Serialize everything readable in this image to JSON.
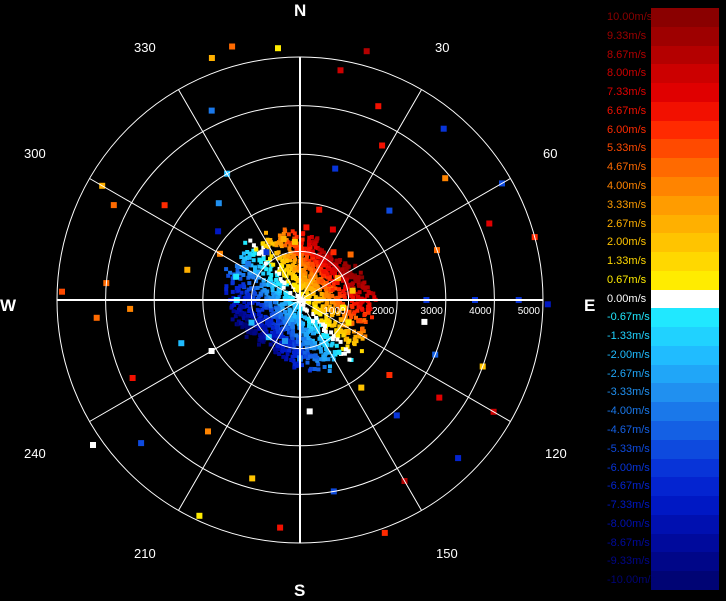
{
  "chart_data": {
    "type": "polar-radial-velocity",
    "compass": {
      "north": "N",
      "east": "E",
      "south": "S",
      "west": "W"
    },
    "azimuth_labels": [
      "30",
      "60",
      "120",
      "150",
      "210",
      "240",
      "300",
      "330"
    ],
    "range_ticks": [
      1000,
      2000,
      3000,
      4000,
      5000
    ],
    "range_tick_labels": [
      "1000",
      "2000",
      "3000",
      "4000",
      "5000"
    ],
    "rmax": 5000,
    "spokes_deg": [
      0,
      30,
      60,
      90,
      120,
      150,
      180,
      210,
      240,
      270,
      300,
      330
    ],
    "legend": [
      {
        "label": "10.00m/s",
        "color": "#8a0000"
      },
      {
        "label": "9.33m/s",
        "color": "#9e0000"
      },
      {
        "label": "8.67m/s",
        "color": "#b40000"
      },
      {
        "label": "8.00m/s",
        "color": "#cc0000"
      },
      {
        "label": "7.33m/s",
        "color": "#e00000"
      },
      {
        "label": "6.67m/s",
        "color": "#f21000"
      },
      {
        "label": "6.00m/s",
        "color": "#ff2a00"
      },
      {
        "label": "5.33m/s",
        "color": "#ff4a00"
      },
      {
        "label": "4.67m/s",
        "color": "#ff6a00"
      },
      {
        "label": "4.00m/s",
        "color": "#ff8400"
      },
      {
        "label": "3.33m/s",
        "color": "#ff9c00"
      },
      {
        "label": "2.67m/s",
        "color": "#ffb000"
      },
      {
        "label": "2.00m/s",
        "color": "#ffc400"
      },
      {
        "label": "1.33m/s",
        "color": "#ffd800"
      },
      {
        "label": "0.67m/s",
        "color": "#ffec00"
      },
      {
        "label": "0.00m/s",
        "color": "#ffffff"
      },
      {
        "label": "-0.67m/s",
        "color": "#20e8ff"
      },
      {
        "label": "-1.33m/s",
        "color": "#20d2ff"
      },
      {
        "label": "-2.00m/s",
        "color": "#20bcff"
      },
      {
        "label": "-2.67m/s",
        "color": "#20a6f8"
      },
      {
        "label": "-3.33m/s",
        "color": "#2090f0"
      },
      {
        "label": "-4.00m/s",
        "color": "#1a78ea"
      },
      {
        "label": "-4.67m/s",
        "color": "#1460e4"
      },
      {
        "label": "-5.33m/s",
        "color": "#0e4ade"
      },
      {
        "label": "-6.00m/s",
        "color": "#0834d8"
      },
      {
        "label": "-6.67m/s",
        "color": "#0424d0"
      },
      {
        "label": "-7.33m/s",
        "color": "#0018c4"
      },
      {
        "label": "-8.00m/s",
        "color": "#0010b0"
      },
      {
        "label": "-8.67m/s",
        "color": "#000a9c"
      },
      {
        "label": "-9.33m/s",
        "color": "#000688"
      },
      {
        "label": "-10.00m/s",
        "color": "#000474"
      }
    ],
    "points": [
      {
        "az": 5,
        "r": 1500,
        "v": 6.5
      },
      {
        "az": 12,
        "r": 1900,
        "v": 7.0
      },
      {
        "az": 25,
        "r": 1600,
        "v": 7.5
      },
      {
        "az": 35,
        "r": 1200,
        "v": 6.0
      },
      {
        "az": 48,
        "r": 1400,
        "v": 5.0
      },
      {
        "az": 60,
        "r": 900,
        "v": 3.5
      },
      {
        "az": 80,
        "r": 1100,
        "v": 2.0
      },
      {
        "az": 100,
        "r": 900,
        "v": 1.0
      },
      {
        "az": 115,
        "r": 1100,
        "v": 0.7
      },
      {
        "az": 130,
        "r": 1000,
        "v": 1.5
      },
      {
        "az": 150,
        "r": 1050,
        "v": -1.5
      },
      {
        "az": 165,
        "r": 1000,
        "v": -3.0
      },
      {
        "az": 180,
        "r": 1200,
        "v": -4.0
      },
      {
        "az": 200,
        "r": 900,
        "v": -3.0
      },
      {
        "az": 220,
        "r": 1000,
        "v": -2.0
      },
      {
        "az": 245,
        "r": 1100,
        "v": -2.0
      },
      {
        "az": 270,
        "r": 1300,
        "v": -1.3
      },
      {
        "az": 290,
        "r": 1400,
        "v": -0.7
      },
      {
        "az": 305,
        "r": 1300,
        "v": -4.0
      },
      {
        "az": 325,
        "r": 1200,
        "v": -6.0
      },
      {
        "az": 345,
        "r": 1300,
        "v": 3.0
      },
      {
        "az": 355,
        "r": 1200,
        "v": 2.0
      },
      {
        "az": 90,
        "r": 2600,
        "v": -6.0
      },
      {
        "az": 90,
        "r": 3600,
        "v": -6.0
      },
      {
        "az": 90,
        "r": 4500,
        "v": -6.0
      },
      {
        "az": 91,
        "r": 5100,
        "v": -7.0
      },
      {
        "az": 265,
        "r": 4200,
        "v": 5.0
      },
      {
        "az": 267,
        "r": 3500,
        "v": 4.0
      },
      {
        "az": 272,
        "r": 4900,
        "v": 5.5
      },
      {
        "az": 275,
        "r": 4000,
        "v": 5.0
      },
      {
        "az": 297,
        "r": 4300,
        "v": 5.0
      },
      {
        "az": 300,
        "r": 4700,
        "v": 3.0
      },
      {
        "az": 305,
        "r": 3400,
        "v": 6.0
      },
      {
        "az": 335,
        "r": 4300,
        "v": -4.0
      },
      {
        "az": 340,
        "r": 5300,
        "v": 3.0
      },
      {
        "az": 345,
        "r": 5400,
        "v": 5.0
      },
      {
        "az": 355,
        "r": 5200,
        "v": 0.7
      },
      {
        "az": 10,
        "r": 4800,
        "v": 8.0
      },
      {
        "az": 15,
        "r": 5300,
        "v": 9.0
      },
      {
        "az": 22,
        "r": 4300,
        "v": 7.0
      },
      {
        "az": 28,
        "r": 3600,
        "v": 6.5
      },
      {
        "az": 40,
        "r": 4600,
        "v": -6.0
      },
      {
        "az": 50,
        "r": 3900,
        "v": 4.0
      },
      {
        "az": 60,
        "r": 4800,
        "v": -5.0
      },
      {
        "az": 68,
        "r": 4200,
        "v": 7.5
      },
      {
        "az": 75,
        "r": 5000,
        "v": 6.0
      },
      {
        "az": 110,
        "r": 4000,
        "v": 2.0
      },
      {
        "az": 120,
        "r": 4600,
        "v": 8.0
      },
      {
        "az": 125,
        "r": 3500,
        "v": 7.5
      },
      {
        "az": 135,
        "r": 4600,
        "v": -6.5
      },
      {
        "az": 140,
        "r": 3100,
        "v": -6.0
      },
      {
        "az": 150,
        "r": 4300,
        "v": 8.5
      },
      {
        "az": 160,
        "r": 5100,
        "v": 6.0
      },
      {
        "az": 170,
        "r": 4000,
        "v": -5.0
      },
      {
        "az": 185,
        "r": 4700,
        "v": 7.0
      },
      {
        "az": 195,
        "r": 3800,
        "v": 2.0
      },
      {
        "az": 205,
        "r": 4900,
        "v": 1.0
      },
      {
        "az": 215,
        "r": 3300,
        "v": 4.0
      },
      {
        "az": 228,
        "r": 4400,
        "v": -5.0
      },
      {
        "az": 235,
        "r": 5200,
        "v": 0.0
      },
      {
        "az": 245,
        "r": 3800,
        "v": 7.0
      },
      {
        "az": 250,
        "r": 2600,
        "v": -2.0
      },
      {
        "az": 285,
        "r": 2400,
        "v": 3.0
      },
      {
        "az": 320,
        "r": 2600,
        "v": -3.0
      },
      {
        "az": 330,
        "r": 3000,
        "v": -2.0
      },
      {
        "az": 15,
        "r": 2800,
        "v": -6.0
      },
      {
        "az": 45,
        "r": 2600,
        "v": -5.0
      },
      {
        "az": 70,
        "r": 3000,
        "v": 5.0
      },
      {
        "az": 100,
        "r": 2600,
        "v": 0.0
      },
      {
        "az": 112,
        "r": 3000,
        "v": -4.5
      },
      {
        "az": 130,
        "r": 2400,
        "v": 6.0
      },
      {
        "az": 145,
        "r": 2200,
        "v": 2.0
      },
      {
        "az": 175,
        "r": 2300,
        "v": 0.0
      },
      {
        "az": 240,
        "r": 2100,
        "v": 0.0
      },
      {
        "az": 300,
        "r": 1900,
        "v": 4.0
      },
      {
        "az": 310,
        "r": 2200,
        "v": -7.0
      }
    ]
  }
}
